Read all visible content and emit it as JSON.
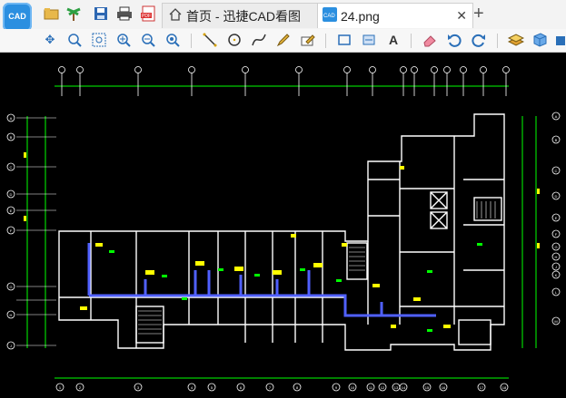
{
  "app": {
    "logo_text": "CAD"
  },
  "tabs": [
    {
      "label": "首页 - 迅捷CAD看图"
    },
    {
      "label": "24.png"
    }
  ],
  "icons": {
    "top": [
      "open-folder-icon",
      "palm-tree-icon",
      "save-icon",
      "print-icon",
      "pdf-export-icon"
    ],
    "tools": [
      "pan-icon",
      "zoom-window-icon",
      "zoom-extents-icon",
      "zoom-in-icon",
      "zoom-out-icon",
      "zoom-previous-icon",
      "line-icon",
      "circle-icon",
      "curve-icon",
      "pencil-icon",
      "edit-text-icon",
      "rectangle-measure-icon",
      "area-icon",
      "text-style-icon",
      "eraser-icon",
      "undo-icon",
      "redo-icon",
      "layers-icon",
      "3d-box-icon"
    ]
  },
  "colors": {
    "canvas_bg": "#000000",
    "walls": "#ffffff",
    "dimensions": "#00ff00",
    "ducts": "#5060ff",
    "labels": "#ffff00"
  },
  "drawing": {
    "bottom_axis_labels": [
      "1",
      "2",
      "3",
      "4",
      "5",
      "6",
      "7",
      "8",
      "9",
      "10",
      "11",
      "12",
      "13",
      "14",
      "15",
      "16",
      "17",
      "18"
    ],
    "left_axis_labels": [
      "A",
      "B",
      "C",
      "D",
      "E",
      "F",
      "G",
      "H",
      "J"
    ],
    "right_axis_labels": [
      "A",
      "B",
      "C",
      "D",
      "E",
      "F",
      "G",
      "H",
      "J",
      "K",
      "L",
      "M"
    ]
  }
}
